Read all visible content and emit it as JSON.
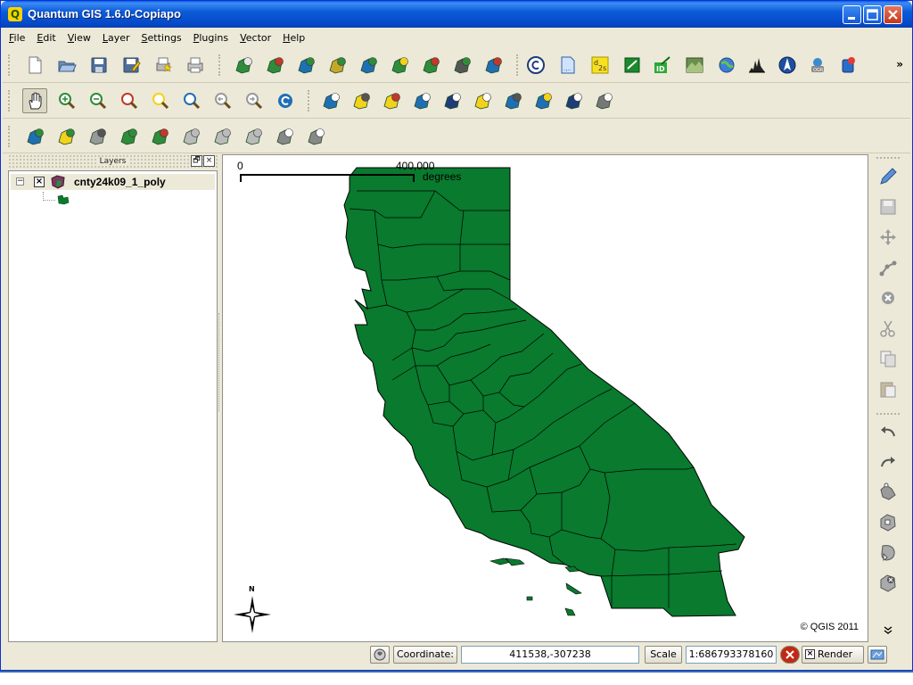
{
  "window": {
    "title": "Quantum GIS 1.6.0-Copiapo",
    "app_icon_glyph": "Q"
  },
  "menu": [
    {
      "u": "F",
      "rest": "ile"
    },
    {
      "u": "E",
      "rest": "dit"
    },
    {
      "u": "V",
      "rest": "iew"
    },
    {
      "u": "L",
      "rest": "ayer"
    },
    {
      "u": "S",
      "rest": "ettings"
    },
    {
      "u": "P",
      "rest": "lugins"
    },
    {
      "u": "V",
      "rest": "ector"
    },
    {
      "u": "H",
      "rest": "elp"
    }
  ],
  "toolbars": {
    "file": [
      "new-project-icon",
      "open-project-icon",
      "save-project-icon",
      "save-as-icon",
      "new-print-composer-icon",
      "print-icon"
    ],
    "layer": [
      "add-vector-layer-icon",
      "add-raster-layer-icon",
      "add-postgis-layer-icon",
      "add-spatialite-layer-icon",
      "add-wms-layer-icon",
      "new-vector-layer-icon",
      "remove-layer-icon",
      "add-wfs-layer-icon",
      "georeferencer-icon"
    ],
    "plugins": [
      "copyright-label-icon",
      "coordinate-capture-icon",
      "dxf2shp-icon",
      "gps-tools-icon",
      "interpolation-icon",
      "raster-terrain-icon",
      "geoprocessing-icon",
      "histogram-icon",
      "north-arrow-icon",
      "ogr-converter-icon",
      "spatial-query-icon"
    ],
    "navigation": [
      "pan-icon",
      "zoom-in-icon",
      "zoom-out-icon",
      "zoom-full-icon",
      "zoom-to-selection-icon",
      "zoom-to-layer-icon",
      "zoom-last-icon",
      "zoom-next-icon",
      "refresh-icon"
    ],
    "attributes": [
      "identify-icon",
      "select-features-icon",
      "deselect-icon",
      "open-attribute-table-icon",
      "measure-icon",
      "map-tips-icon",
      "new-bookmark-icon",
      "show-bookmarks-icon",
      "annotation-icon",
      "text-annotation-icon"
    ],
    "manage": [
      "add-layers-to-overview-icon",
      "new-layer-icon",
      "remove-from-overview-icon",
      "show-all-layers-icon",
      "hide-all-layers-icon",
      "toggle-editing-icon",
      "capture-line-icon",
      "capture-polygon-icon",
      "simplify-icon",
      "delete-part-icon"
    ]
  },
  "layers_panel": {
    "title": "Layers",
    "layer_name": "cnty24k09_1_poly",
    "checked": "×",
    "expanded_glyph": "−",
    "restore_glyph": "🗗",
    "close_glyph": "×"
  },
  "map": {
    "scale_left": "0",
    "scale_right": "400,000",
    "scale_units": "degrees",
    "copyright": "© QGIS 2011",
    "north_label": "N",
    "fill_color": "#097a2e",
    "outline_color": "#000000"
  },
  "statusbar": {
    "coordinate_label": "Coordinate:",
    "coordinate_value": "411538,-307238",
    "scale_label": "Scale",
    "scale_value": "1:686793378160",
    "render_label": "Render",
    "render_checked": "×"
  },
  "more_chevron": "»"
}
